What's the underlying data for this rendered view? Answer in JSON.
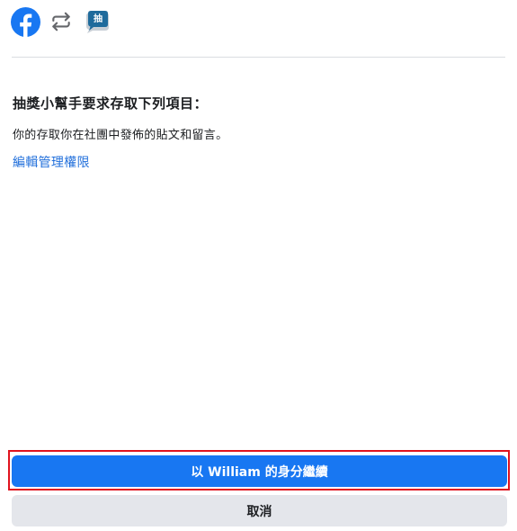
{
  "header": {
    "icons": [
      "facebook-logo-icon",
      "connect-arrows-icon",
      "app-chat-bubble-icon"
    ],
    "app_icon_text": "抽"
  },
  "permission": {
    "heading": "抽獎小幫手要求存取下列項目：",
    "item": "你的存取你在社團中發佈的貼文和留言。",
    "edit_link": "編輯管理權限"
  },
  "actions": {
    "continue_label": "以 William 的身分繼續",
    "cancel_label": "取消"
  },
  "colors": {
    "facebook_blue": "#1877f2",
    "link_blue": "#216fdb",
    "cancel_gray": "#e4e6eb",
    "divider_gray": "#dadde1",
    "app_icon_blue": "#1f6b9c",
    "focus_red": "#e0131e",
    "text_dark": "#1c1e21"
  }
}
